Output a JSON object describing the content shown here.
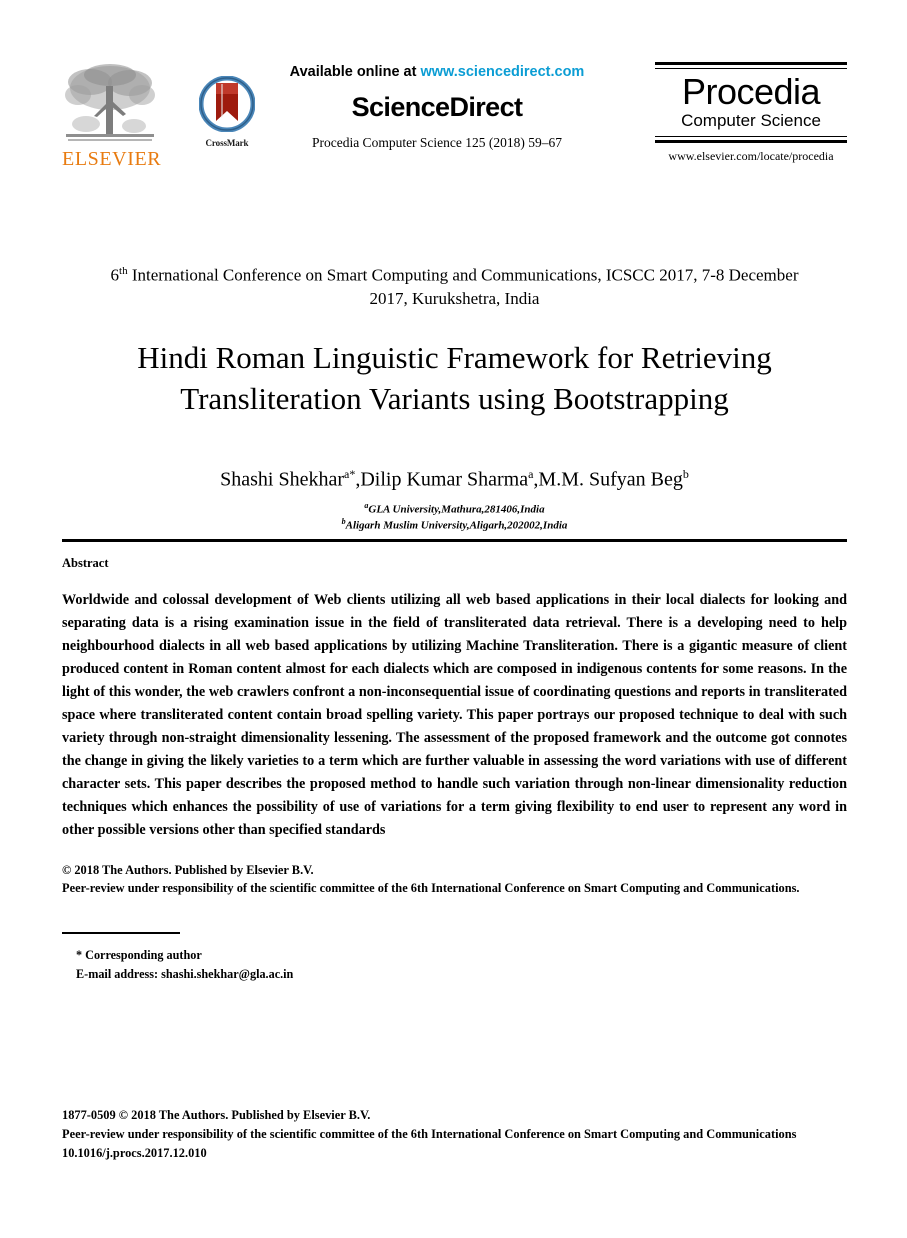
{
  "masthead": {
    "elsevier_wordmark": "ELSEVIER",
    "crossmark_label": "CrossMark",
    "available_prefix": "Available online at ",
    "available_url": "www.sciencedirect.com",
    "sciencedirect_title": "ScienceDirect",
    "journal_line": "Procedia Computer Science 125 (2018) 59–67",
    "procedia_name": "Procedia",
    "procedia_subtitle": "Computer Science",
    "procedia_url": "www.elsevier.com/locate/procedia",
    "colors": {
      "elsevier_orange": "#E87B10",
      "link_blue": "#0b9dd4",
      "crossmark_ring": "#3f7fb5",
      "crossmark_ribbon": "#9e1b0e"
    }
  },
  "conference": {
    "ordinal": "6",
    "ordinal_suffix": "th",
    "line": " International Conference on Smart Computing and Communications, ICSCC 2017, 7-8 December 2017, Kurukshetra, India"
  },
  "paper": {
    "title": "Hindi Roman Linguistic Framework for Retrieving Transliteration Variants using Bootstrapping"
  },
  "authors": {
    "author1_name": "Shashi Shekhar",
    "author1_marks": "a*",
    "sep1": ",",
    "author2_name": "Dilip Kumar Sharma",
    "author2_marks": "a",
    "sep2": ",",
    "author3_name": "M.M. Sufyan Beg",
    "author3_marks": "b",
    "affiliations": [
      {
        "mark": "a",
        "text": "GLA University,Mathura,281406,India"
      },
      {
        "mark": "b",
        "text": "Aligarh Muslim University,Aligarh,202002,India"
      }
    ]
  },
  "abstract": {
    "heading": "Abstract",
    "body": "Worldwide and colossal development of Web clients utilizing all web based applications in their local dialects for looking and separating data is a rising examination issue in the field of transliterated data retrieval. There is a developing need to help neighbourhood dialects in all web based applications by utilizing Machine Transliteration. There is a gigantic measure of client produced content in Roman content almost for each dialects which are composed in indigenous contents for some reasons. In the light of this wonder, the web crawlers confront a non-inconsequential issue of coordinating questions and reports in transliterated space where transliterated content contain broad spelling variety. This paper portrays our proposed technique to deal with such variety through non-straight dimensionality lessening. The assessment of the proposed framework and the outcome got connotes the change in giving the likely varieties to a term which are further valuable in assessing the word variations with use of different character sets. This paper describes the proposed method to handle such variation through non-linear dimensionality reduction techniques which enhances the possibility of use of variations for a term giving flexibility to end user to represent any word in other possible versions other than specified standards",
    "copyright_line": "© 2018 The Authors. Published by Elsevier B.V.",
    "peer_review_line": "Peer-review under responsibility of the scientific committee of the 6th International Conference on Smart Computing and Communications."
  },
  "footnote": {
    "corresponding": "* Corresponding author",
    "email_label": "E-mail address: ",
    "email": "shashi.shekhar@gla.ac.in"
  },
  "footer": {
    "issn_line": "1877-0509 © 2018 The Authors. Published by Elsevier B.V.",
    "peer_review_line": "Peer-review under responsibility of the scientific committee of the 6th International Conference on Smart Computing and Communications",
    "doi": "10.1016/j.procs.2017.12.010"
  }
}
